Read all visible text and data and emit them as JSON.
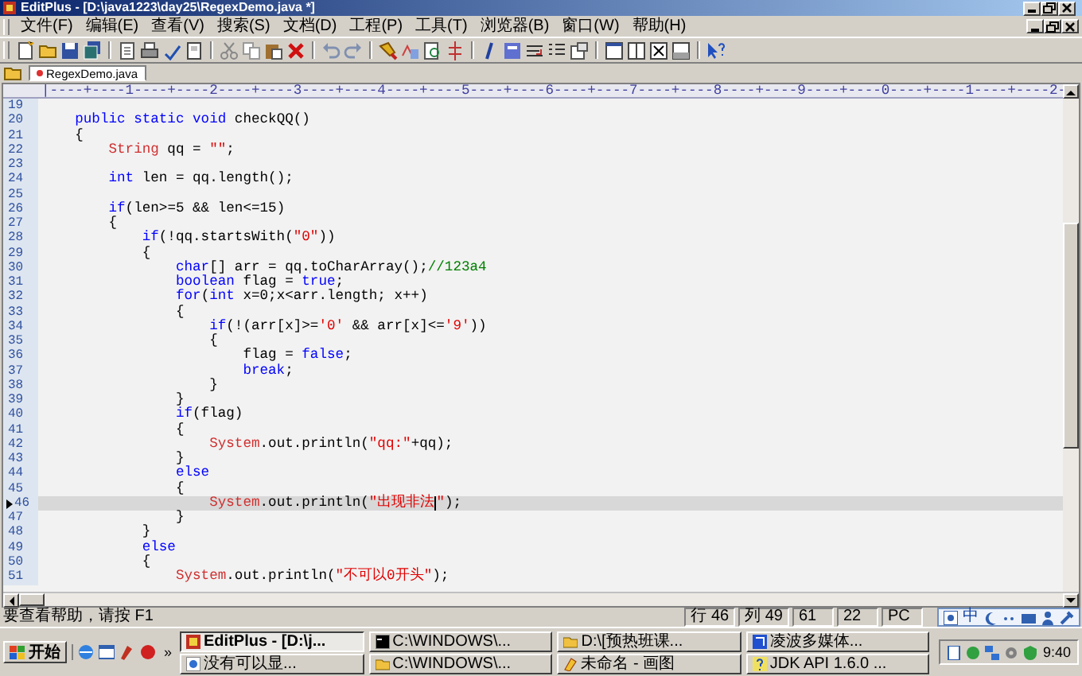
{
  "window": {
    "title": "EditPlus - [D:\\java1223\\day25\\RegexDemo.java *]"
  },
  "menu": [
    "文件(F)",
    "编辑(E)",
    "查看(V)",
    "搜索(S)",
    "文档(D)",
    "工程(P)",
    "工具(T)",
    "浏览器(B)",
    "窗口(W)",
    "帮助(H)"
  ],
  "document_tabs": [
    {
      "label": "RegexDemo.java",
      "selected": true,
      "modified": true
    }
  ],
  "ruler": "|----+----1----+----2----+----3----+----4----+----5----+----6----+----7----+----8----+----9----+----0----+----1----+----2-",
  "editor": {
    "lines": [
      {
        "number": "19",
        "current": false
      },
      {
        "number": "20",
        "current": false,
        "tokens": [
          {
            "text": "    public static void",
            "kind": "keyword"
          },
          {
            "text": " checkQQ()"
          }
        ]
      },
      {
        "number": "21",
        "current": false,
        "tokens": [
          {
            "text": "    {"
          }
        ]
      },
      {
        "number": "22",
        "current": false,
        "tokens": [
          {
            "text": "        String",
            "kind": "class"
          },
          {
            "text": " qq = "
          },
          {
            "text": "\"\"",
            "kind": "string"
          },
          {
            "text": ";"
          }
        ]
      },
      {
        "number": "23",
        "current": false
      },
      {
        "number": "24",
        "current": false,
        "tokens": [
          {
            "text": "        int",
            "kind": "keyword"
          },
          {
            "text": " len = qq.length();"
          }
        ]
      },
      {
        "number": "25",
        "current": false
      },
      {
        "number": "26",
        "current": false,
        "tokens": [
          {
            "text": "        if",
            "kind": "keyword"
          },
          {
            "text": "(len>=5 && len<=15)"
          }
        ]
      },
      {
        "number": "27",
        "current": false,
        "tokens": [
          {
            "text": "        {"
          }
        ]
      },
      {
        "number": "28",
        "current": false,
        "tokens": [
          {
            "text": "            if",
            "kind": "keyword"
          },
          {
            "text": "(!qq.startsWith("
          },
          {
            "text": "\"0\"",
            "kind": "string"
          },
          {
            "text": "))"
          }
        ]
      },
      {
        "number": "29",
        "current": false,
        "tokens": [
          {
            "text": "            {"
          }
        ]
      },
      {
        "number": "30",
        "current": false,
        "tokens": [
          {
            "text": "                char",
            "kind": "keyword"
          },
          {
            "text": "[] arr = qq.toCharArray();"
          },
          {
            "text": "//123a4",
            "kind": "comment"
          }
        ]
      },
      {
        "number": "31",
        "current": false,
        "tokens": [
          {
            "text": "                boolean",
            "kind": "keyword"
          },
          {
            "text": " flag = "
          },
          {
            "text": "true",
            "kind": "keyword"
          },
          {
            "text": ";"
          }
        ]
      },
      {
        "number": "32",
        "current": false,
        "tokens": [
          {
            "text": "                for",
            "kind": "keyword"
          },
          {
            "text": "("
          },
          {
            "text": "int",
            "kind": "keyword"
          },
          {
            "text": " x=0;x<arr.length; x++)"
          }
        ]
      },
      {
        "number": "33",
        "current": false,
        "tokens": [
          {
            "text": "                {"
          }
        ]
      },
      {
        "number": "34",
        "current": false,
        "tokens": [
          {
            "text": "                    if",
            "kind": "keyword"
          },
          {
            "text": "(!(arr[x]>="
          },
          {
            "text": "'0'",
            "kind": "string"
          },
          {
            "text": " && arr[x]<="
          },
          {
            "text": "'9'",
            "kind": "string"
          },
          {
            "text": "))"
          }
        ]
      },
      {
        "number": "35",
        "current": false,
        "tokens": [
          {
            "text": "                    {"
          }
        ]
      },
      {
        "number": "36",
        "current": false,
        "tokens": [
          {
            "text": "                        flag = "
          },
          {
            "text": "false",
            "kind": "keyword"
          },
          {
            "text": ";"
          }
        ]
      },
      {
        "number": "37",
        "current": false,
        "tokens": [
          {
            "text": "                        break",
            "kind": "keyword"
          },
          {
            "text": ";"
          }
        ]
      },
      {
        "number": "38",
        "current": false,
        "tokens": [
          {
            "text": "                    }"
          }
        ]
      },
      {
        "number": "39",
        "current": false,
        "tokens": [
          {
            "text": "                }"
          }
        ]
      },
      {
        "number": "40",
        "current": false,
        "tokens": [
          {
            "text": "                if",
            "kind": "keyword"
          },
          {
            "text": "(flag)"
          }
        ]
      },
      {
        "number": "41",
        "current": false,
        "tokens": [
          {
            "text": "                {"
          }
        ]
      },
      {
        "number": "42",
        "current": false,
        "tokens": [
          {
            "text": "                    System",
            "kind": "class"
          },
          {
            "text": ".out.println("
          },
          {
            "text": "\"qq:\"",
            "kind": "string"
          },
          {
            "text": "+qq);"
          }
        ]
      },
      {
        "number": "43",
        "current": false,
        "tokens": [
          {
            "text": "                }"
          }
        ]
      },
      {
        "number": "44",
        "current": false,
        "tokens": [
          {
            "text": "                else",
            "kind": "keyword"
          }
        ]
      },
      {
        "number": "45",
        "current": false,
        "tokens": [
          {
            "text": "                {"
          }
        ]
      },
      {
        "number": "46",
        "current": true,
        "tokens": [
          {
            "text": "                    System",
            "kind": "class"
          },
          {
            "text": ".out.println("
          },
          {
            "text": "\"出现非法",
            "kind": "string",
            "caret": true
          },
          {
            "text": "\"",
            "kind": "string"
          },
          {
            "text": ");"
          }
        ]
      },
      {
        "number": "47",
        "current": false,
        "tokens": [
          {
            "text": "                }"
          }
        ]
      },
      {
        "number": "48",
        "current": false,
        "tokens": [
          {
            "text": "            }"
          }
        ]
      },
      {
        "number": "49",
        "current": false,
        "tokens": [
          {
            "text": "            else",
            "kind": "keyword"
          }
        ]
      },
      {
        "number": "50",
        "current": false,
        "tokens": [
          {
            "text": "            {"
          }
        ]
      },
      {
        "number": "51",
        "current": false,
        "tokens": [
          {
            "text": "                System",
            "kind": "class"
          },
          {
            "text": ".out.println("
          },
          {
            "text": "\"不可以0开头\"",
            "kind": "string"
          },
          {
            "text": ");"
          }
        ]
      }
    ]
  },
  "status_bar": {
    "message": "要查看帮助，请按 F1",
    "fields": [
      "行 46",
      "列 49",
      "61",
      "22",
      "PC"
    ]
  },
  "ime_bar": {
    "mode": "中"
  },
  "taskbar": {
    "start": "开始",
    "more": "»",
    "clock": "9:40",
    "tasks": [
      {
        "label": "EditPlus - [D:\\j...",
        "kind": "editor",
        "selected": true
      },
      {
        "label": "C:\\WINDOWS\\...",
        "kind": "console",
        "selected": false
      },
      {
        "label": "D:\\[预热班课...",
        "kind": "folder",
        "selected": false
      },
      {
        "label": "凌波多媒体...",
        "kind": "media",
        "selected": false
      },
      {
        "label": "没有可以显...",
        "kind": "browser",
        "selected": false
      },
      {
        "label": "C:\\WINDOWS\\...",
        "kind": "folder",
        "selected": false
      },
      {
        "label": "未命名 - 画图",
        "kind": "paint",
        "selected": false
      },
      {
        "label": "JDK API 1.6.0 ...",
        "kind": "help",
        "selected": false
      }
    ]
  }
}
